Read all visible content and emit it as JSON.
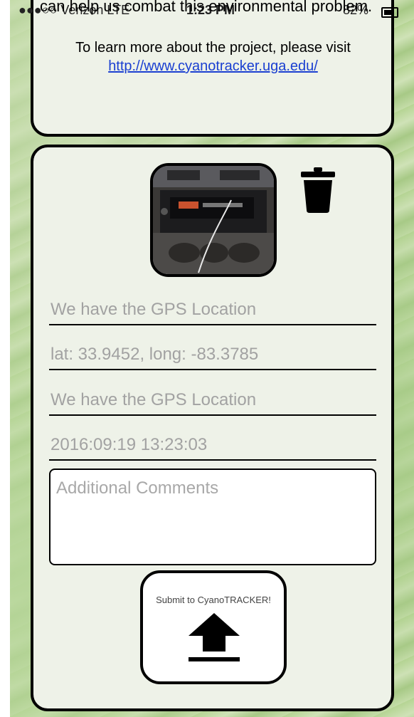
{
  "status_bar": {
    "carrier": "●●●○○ Verizon LTE",
    "time": "1:23 PM",
    "battery": "82%"
  },
  "overlay_text": "can help us combat this environmental problem.",
  "info_card": {
    "learn_text": "To learn more about the project, please visit",
    "link": "http://www.cyanotracker.uga.edu/"
  },
  "form": {
    "fields": [
      "We have the GPS Location",
      "lat: 33.9452, long: -83.3785",
      "We have the GPS Location",
      "2016:09:19 13:23:03"
    ],
    "comments_placeholder": "Additional Comments",
    "submit_label": "Submit to CyanoTRACKER!"
  },
  "icons": {
    "photo": "photo-thumbnail",
    "delete": "trash-icon",
    "upload": "upload-arrow-icon"
  }
}
